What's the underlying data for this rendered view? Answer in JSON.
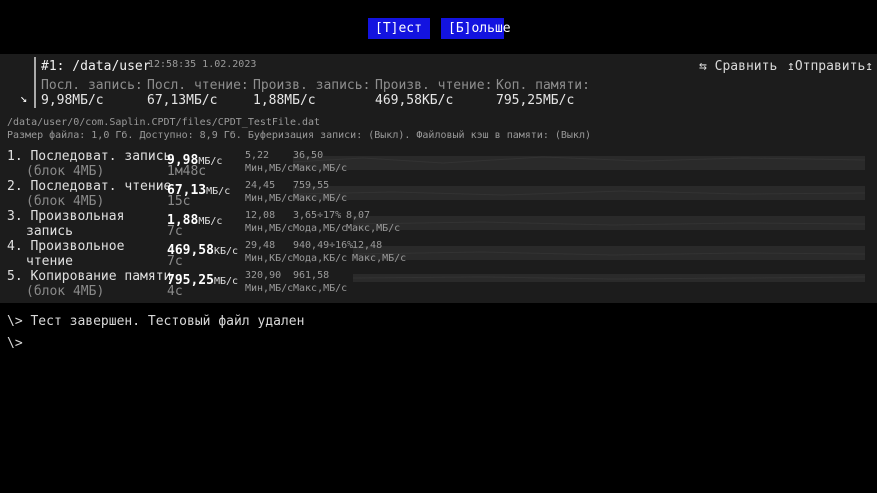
{
  "toolbar": {
    "test": "[Т]ест",
    "more": "[Б]ольше"
  },
  "history": {
    "title": "#1: /data/user",
    "timestamp": "12:58:35 1.02.2023",
    "compare": "⇆ Сравнить",
    "send": "↥Отправить↥",
    "selected_icon": "↘",
    "columns": [
      {
        "label": "Посл. запись:",
        "value": "9,98МБ/с"
      },
      {
        "label": "Посл. чтение:",
        "value": "67,13МБ/с"
      },
      {
        "label": "Произв. запись:",
        "value": "1,88МБ/с"
      },
      {
        "label": "Произв. чтение:",
        "value": "469,58КБ/с"
      },
      {
        "label": "Коп. памяти:",
        "value": "795,25МБ/с"
      }
    ]
  },
  "file": {
    "path": "/data/user/0/com.Saplin.CPDT/files/CPDT_TestFile.dat",
    "info": "Размер файла: 1,0 Гб. Доступно: 8,9 Гб. Буферизация записи: (Выкл). Файловый кэш в памяти: (Выкл)"
  },
  "tests": [
    {
      "name": "1. Последоват. запись",
      "sub": "(блок 4МБ)",
      "value": "9,98",
      "unit": "МБ/с",
      "time": "1м48с",
      "stats": [
        {
          "num": "5,22",
          "label": "Мин,МБ/с"
        },
        {
          "num": "36,50",
          "label": "Макс,МБ/с"
        }
      ]
    },
    {
      "name": "2. Последоват. чтение",
      "sub": "(блок 4МБ)",
      "value": "67,13",
      "unit": "МБ/с",
      "time": "15с",
      "stats": [
        {
          "num": "24,45",
          "label": "Мин,МБ/с"
        },
        {
          "num": "759,55",
          "label": "Макс,МБ/с"
        }
      ]
    },
    {
      "name": "3. Произвольная",
      "sub": "запись",
      "value": "1,88",
      "unit": "МБ/с",
      "time": "7с",
      "stats": [
        {
          "num": "12,08",
          "label": "Мин,МБ/с"
        },
        {
          "num": "3,65÷17%",
          "label": "Мода,МБ/с"
        },
        {
          "num": "8,07",
          "label": "Макс,МБ/с"
        }
      ]
    },
    {
      "name": "4. Произвольное",
      "sub": "чтение",
      "value": "469,58",
      "unit": "КБ/с",
      "time": "7с",
      "stats": [
        {
          "num": "29,48",
          "label": "Мин,КБ/с"
        },
        {
          "num": "940,49÷16%",
          "label": "Мода,КБ/с"
        },
        {
          "num": "12,48",
          "label": "Макс,МБ/с"
        }
      ]
    },
    {
      "name": "5. Копирование памяти",
      "sub": "(блок 4МБ)",
      "value": "795,25",
      "unit": "МБ/с",
      "time": "4с",
      "stats": [
        {
          "num": "320,90",
          "label": "Мин,МБ/с"
        },
        {
          "num": "961,58",
          "label": "Макс,МБ/с"
        }
      ]
    }
  ],
  "log": [
    "\\> Тест завершен. Тестовый файл удален",
    "\\>"
  ],
  "colors": {
    "button_bg": "#1313e0",
    "panel_bg": "#1c1c1c",
    "background": "#000000"
  }
}
